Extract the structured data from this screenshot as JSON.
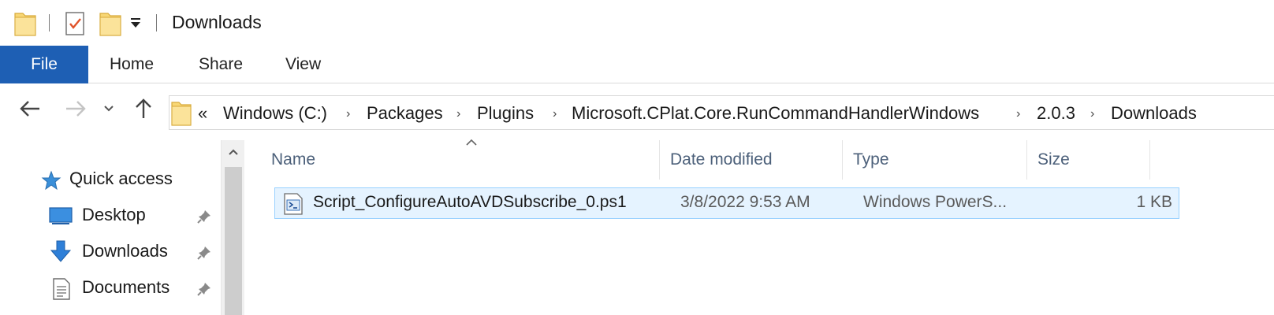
{
  "window": {
    "title": "Downloads"
  },
  "quick_access_toolbar": {
    "icons": [
      "folder-icon",
      "properties-icon",
      "new-folder-icon",
      "customize-dropdown-icon"
    ]
  },
  "ribbon": {
    "tabs": [
      {
        "label": "File",
        "active": true
      },
      {
        "label": "Home"
      },
      {
        "label": "Share"
      },
      {
        "label": "View"
      }
    ],
    "accent_color": "#1e5fb4"
  },
  "navigation": {
    "back_icon": "arrow-left-icon",
    "forward_icon": "arrow-right-icon",
    "recent_icon": "chevron-down-icon",
    "up_icon": "arrow-up-icon"
  },
  "address_bar": {
    "overflow": "«",
    "breadcrumbs": [
      "Windows (C:)",
      "Packages",
      "Plugins",
      "Microsoft.CPlat.Core.RunCommandHandlerWindows",
      "2.0.3",
      "Downloads"
    ]
  },
  "nav_pane": {
    "quick_access_label": "Quick access",
    "items": [
      {
        "label": "Desktop",
        "icon": "desktop-icon",
        "pinned": true
      },
      {
        "label": "Downloads",
        "icon": "downloads-icon",
        "pinned": true
      },
      {
        "label": "Documents",
        "icon": "documents-icon",
        "pinned": true
      }
    ]
  },
  "file_list": {
    "columns": [
      "Name",
      "Date modified",
      "Type",
      "Size"
    ],
    "sort_column": "Name",
    "rows": [
      {
        "name": "Script_ConfigureAutoAVDSubscribe_0.ps1",
        "date_modified": "3/8/2022 9:53 AM",
        "type": "Windows PowerS...",
        "size": "1 KB",
        "icon": "powershell-script-icon",
        "selected": true
      }
    ]
  }
}
